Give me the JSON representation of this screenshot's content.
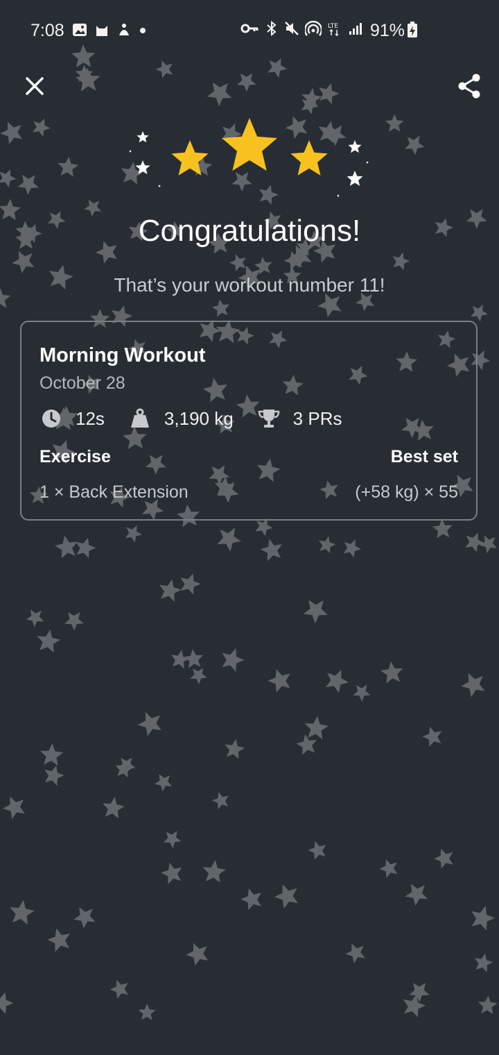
{
  "status_bar": {
    "time": "7:08",
    "battery": "91%"
  },
  "celebration": {
    "title": "Congratulations!",
    "subtitle": "That’s your workout number 11!"
  },
  "workout": {
    "name": "Morning Workout",
    "date": "October 28",
    "duration": "12s",
    "volume": "3,190 kg",
    "prs": "3 PRs",
    "columns": {
      "exercise": "Exercise",
      "best_set": "Best set"
    },
    "rows": [
      {
        "exercise": "1 × Back Extension",
        "best_set": "(+58 kg) × 55"
      }
    ]
  },
  "icons": {
    "close": "close-icon",
    "share": "share-icon",
    "clock": "clock-icon",
    "weight": "weight-icon",
    "trophy": "trophy-icon"
  },
  "colors": {
    "background": "#282d34",
    "gold_star": "#f7c21f",
    "confetti_star": "#62656a"
  }
}
